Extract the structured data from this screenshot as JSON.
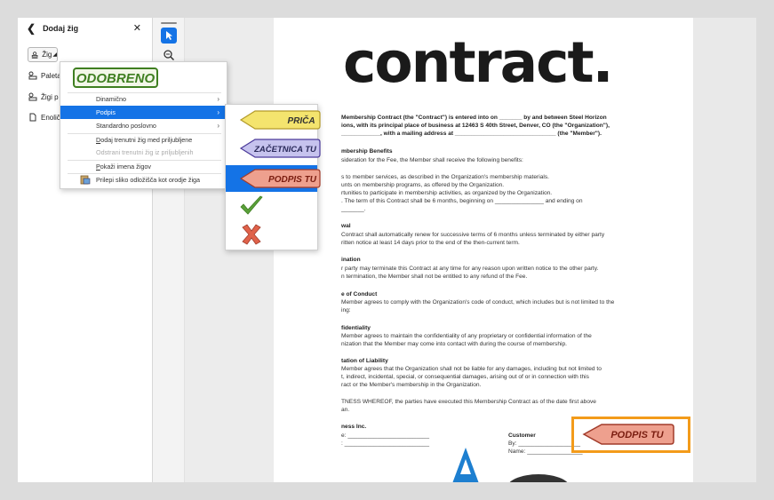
{
  "panel": {
    "title": "Dodaj žig",
    "stamp_label": "Žig",
    "items": [
      "Paleta",
      "Žigi p",
      "Enolič"
    ]
  },
  "stamp_menu": {
    "preview_text": "ODOBRENO",
    "items": [
      {
        "label": "Dinamično",
        "has_submenu": true
      },
      {
        "label": "Podpis",
        "has_submenu": true,
        "active": true
      },
      {
        "label": "Standardno poslovno",
        "has_submenu": true
      },
      {
        "label": "Dodaj trenutni žig med priljubljene"
      },
      {
        "label": "Odstrani trenutni žig iz priljubljenih",
        "disabled": true
      },
      {
        "label": "Pokaži imena žigov"
      },
      {
        "label": "Prilepi sliko odložišča kot orodje žiga"
      }
    ]
  },
  "signature_submenu": {
    "stamps": [
      "PRIČA",
      "ZAČETNICA TU",
      "PODPIS TU"
    ],
    "check_icon": "checkmark-icon",
    "x_icon": "x-mark-icon"
  },
  "document": {
    "title": "contract.",
    "lines": [
      {
        "t": "Membership Contract (the \"Contract\") is entered into on _______ by and between Steel Horizon",
        "b": true
      },
      {
        "t": "ions, with its principal place of business at 12463 S 40th Street, Denver, CO (the \"Organization\"),",
        "b": true
      },
      {
        "t": "____________, with a mailing address at _______________________________ (the \"Member\").",
        "b": true
      },
      {
        "t": "mbership Benefits",
        "b": true
      },
      {
        "t": "sideration for the Fee, the Member shall receive the following benefits:"
      },
      {
        "t": "s to member services, as described in the Organization's membership materials."
      },
      {
        "t": "unts on membership programs, as offered by the Organization."
      },
      {
        "t": "rtunities to participate in membership activities, as organized by the Organization."
      },
      {
        "t": ". The term of this Contract shall be 6 months, beginning on _______________ and ending on"
      },
      {
        "t": "_______."
      },
      {
        "t": "wal",
        "b": true
      },
      {
        "t": "Contract shall automatically renew for successive terms of 6 months unless terminated by either party"
      },
      {
        "t": "ritten notice at least 14 days prior to the end of the then-current term."
      },
      {
        "t": "ination",
        "b": true
      },
      {
        "t": "r party may terminate this Contract at any time for any reason upon written notice to the other party."
      },
      {
        "t": "n termination, the Member shall not be entitled to any refund of the Fee."
      },
      {
        "t": "e of Conduct",
        "b": true
      },
      {
        "t": "Member agrees to comply with the Organization's code of conduct, which includes but is not limited to the"
      },
      {
        "t": "ing:"
      },
      {
        "t": "fidentiality",
        "b": true
      },
      {
        "t": "Member agrees to maintain the confidentiality of any proprietary or confidential information of the"
      },
      {
        "t": "nization that the Member may come into contact with during the course of membership."
      },
      {
        "t": "tation of Liability",
        "b": true
      },
      {
        "t": "Member agrees that the Organization shall not be liable for any damages, including but not limited to"
      },
      {
        "t": "t, indirect, incidental, special, or consequential damages, arising out of or in connection with this"
      },
      {
        "t": "ract or the Member's membership in the Organization."
      },
      {
        "t": "TNESS WHEREOF, the parties have executed this Membership Contract as of the date first above"
      },
      {
        "t": "an."
      },
      {
        "t": "ness Inc.",
        "b": true
      },
      {
        "t": "e: _________________________"
      },
      {
        "t": ": __________________________"
      }
    ],
    "customer_label": "Customer",
    "by_label": "By: ___________________",
    "name_label": "Name: _________________"
  },
  "placed_stamp": {
    "label": "PODPIS TU"
  },
  "colors": {
    "accent": "#1473e6",
    "highlight": "#f39b1a",
    "stamp_green": "#3f7f21",
    "yellow_fill": "#f4e46e",
    "purple_fill": "#c6c3ee",
    "red_fill": "#eea08e"
  }
}
